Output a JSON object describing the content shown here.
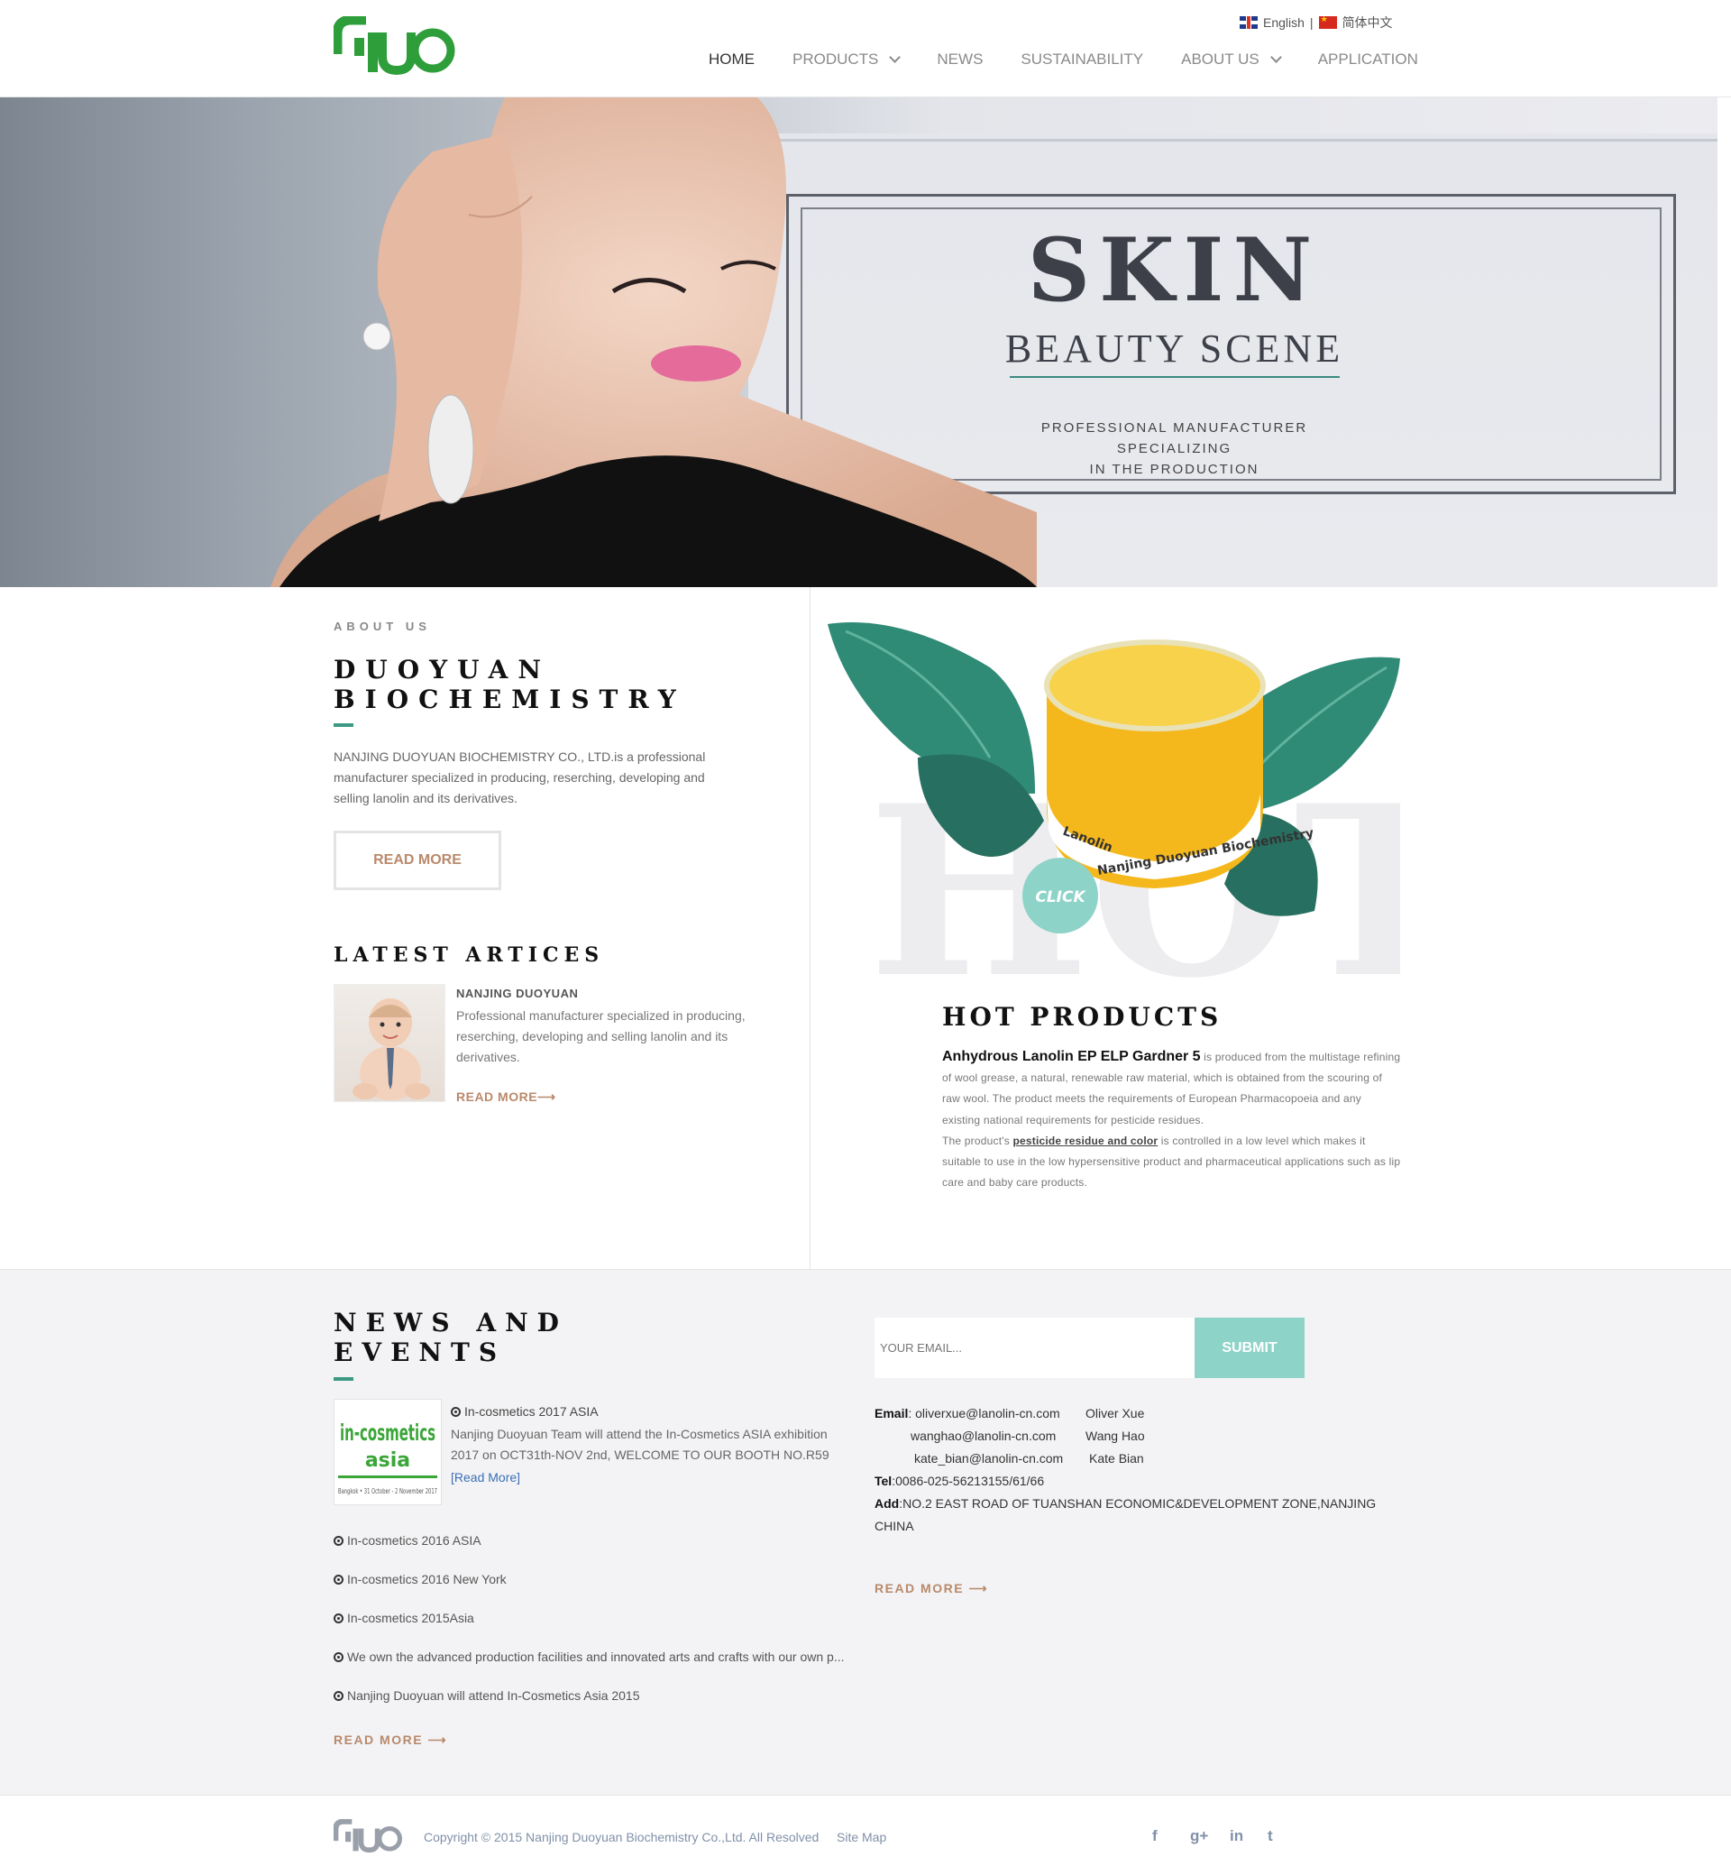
{
  "header": {
    "lang_en": "English",
    "lang_sep": "|",
    "lang_cn": "简体中文",
    "nav": [
      {
        "label": "HOME",
        "active": true
      },
      {
        "label": "PRODUCTS",
        "dropdown": true
      },
      {
        "label": "NEWS"
      },
      {
        "label": "SUSTAINABILITY"
      },
      {
        "label": "ABOUT US",
        "dropdown": true
      },
      {
        "label": "APPLICATION"
      }
    ]
  },
  "hero": {
    "title": "SKIN",
    "subtitle": "BEAUTY SCENE",
    "desc_line1": "PROFESSIONAL MANUFACTURER SPECIALIZING",
    "desc_line2": "IN THE PRODUCTION"
  },
  "about": {
    "eyebrow": "ABOUT US",
    "title_line1": "DUOYUAN",
    "title_line2": "BIOCHEMISTRY",
    "text": "NANJING DUOYUAN BIOCHEMISTRY CO., LTD.is a professional manufacturer specialized in producing, reserching, developing and selling lanolin and its derivatives.",
    "button": "READ MORE"
  },
  "latest": {
    "title": "LATEST ARTICES",
    "article_name": "NANJING DUOYUAN",
    "article_text": "Professional manufacturer specialized in producing, reserching, developing and selling lanolin and its derivatives.",
    "article_more": "READ MORE⟶"
  },
  "hot": {
    "image_lid_text1": "Lanolin",
    "image_lid_text2": "Nanjing Duoyuan Biochemistry",
    "click_label": "CLICK",
    "title": "HOT PRODUCTS",
    "product_name": "Anhydrous Lanolin EP ELP Gardner 5",
    "desc1": " is produced from the multistage refining of wool grease, a natural, renewable raw material, which is obtained from the scouring of raw wool. The product meets the requirements of European Pharmacopoeia and any existing national requirements for pesticide residues.",
    "desc2_pre": "The product's ",
    "desc2_link": "pesticide residue and color",
    "desc2_post": "  is controlled in a low level which makes it suitable to use in the low hypersensitive product and pharmaceutical applications such as lip care and baby care products."
  },
  "news": {
    "title_line1": "NEWS AND",
    "title_line2": "EVENTS",
    "thumb_title": "in-cosmetics",
    "thumb_sub": "asia",
    "thumb_date": "Bangkok • 31 October - 2 November 2017",
    "feature_title": "In-cosmetics 2017 ASIA",
    "feature_text": "Nanjing Duoyuan Team will attend the In-Cosmetics ASIA exhibition 2017 on OCT31th-NOV 2nd, WELCOME TO OUR BOOTH NO.R59",
    "feature_more": "[Read More]",
    "items": [
      "In-cosmetics 2016 ASIA",
      "In-cosmetics 2016 New York",
      "In-cosmetics 2015Asia",
      "We own the advanced production facilities and innovated arts and crafts with our own p...",
      "Nanjing Duoyuan will attend In-Cosmetics Asia 2015"
    ],
    "more": "READ MORE ⟶"
  },
  "contact": {
    "email_placeholder": "YOUR EMAIL...",
    "submit": "SUBMIT",
    "email_label": "Email",
    "emails": [
      {
        "email": "oliverxue@lanolin-cn.com",
        "name": "Oliver Xue"
      },
      {
        "email": "wanghao@lanolin-cn.com",
        "name": "Wang Hao"
      },
      {
        "email": "kate_bian@lanolin-cn.com",
        "name": "Kate Bian"
      }
    ],
    "tel_label": "Tel",
    "tel": ":0086-025-56213155/61/66",
    "add_label": "Add",
    "address_line1": ":NO.2 EAST ROAD OF TUANSHAN ECONOMIC&DEVELOPMENT ZONE,NANJING",
    "address_line2": "CHINA",
    "more": "READ MORE ⟶"
  },
  "footer": {
    "copyright": "Copyright © 2015 Nanjing Duoyuan Biochemistry Co.,Ltd. All Resolved",
    "sitemap": "Site Map",
    "social": [
      "f",
      "g+",
      "in",
      "t"
    ]
  },
  "colors": {
    "accent": "#3c9a84",
    "logo_green": "#2e9e3a",
    "brown": "#b9896b",
    "submit": "#8ed3c8"
  }
}
